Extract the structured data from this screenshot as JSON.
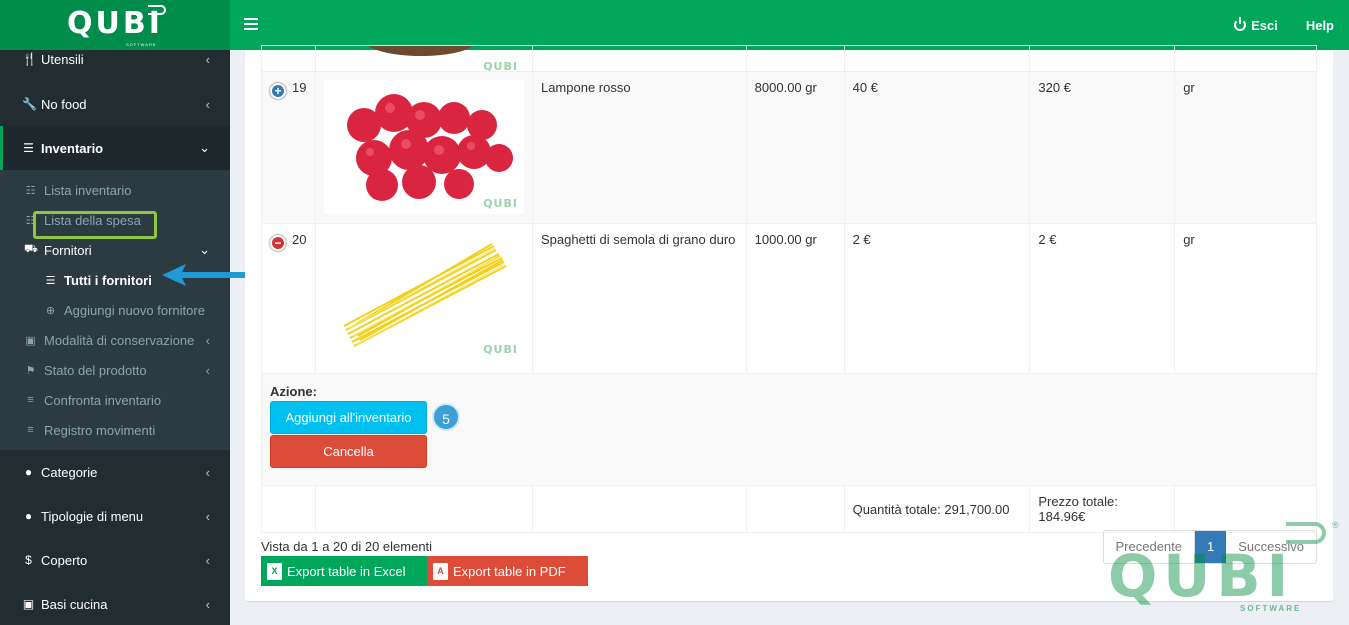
{
  "header": {
    "logo": "QUBI",
    "logo_sub": "SOFTWARE",
    "logout": "Esci",
    "help": "Help"
  },
  "sidebar": {
    "items": [
      {
        "label": "Utensili",
        "icon": "cutlery-icon"
      },
      {
        "label": "No food",
        "icon": "wrench-icon"
      },
      {
        "label": "Inventario",
        "icon": "table-icon"
      }
    ],
    "sub_items": [
      {
        "label": "Lista inventario"
      },
      {
        "label": "Lista della spesa"
      },
      {
        "label": "Fornitori"
      },
      {
        "label": "Tutti i fornitori"
      },
      {
        "label": "Aggiungi nuovo fornitore"
      },
      {
        "label": "Modalità di conservazione"
      },
      {
        "label": "Stato del prodotto"
      },
      {
        "label": "Confronta inventario"
      },
      {
        "label": "Registro movimenti"
      }
    ],
    "bottom_items": [
      {
        "label": "Categorie"
      },
      {
        "label": "Tipologie di menu"
      },
      {
        "label": "Coperto"
      },
      {
        "label": "Basi cucina"
      }
    ]
  },
  "table": {
    "rows": [
      {
        "id": "19",
        "name": "Lampone rosso",
        "qty": "8000.00 gr",
        "price": "40 €",
        "total": "320 €",
        "unit": "gr"
      },
      {
        "id": "20",
        "name": "Spaghetti di semola di grano duro",
        "qty": "1000.00 gr",
        "price": "2 €",
        "total": "2 €",
        "unit": "gr"
      }
    ],
    "watermark": "QUBI",
    "action_label": "Azione:",
    "add_button": "Aggiungi all'inventario",
    "cancel_button": "Cancella",
    "step": "5",
    "total_qty": "Quantità totale: 291,700.00",
    "total_price": "Prezzo totale: 184.96€"
  },
  "footer": {
    "info": "Vista da 1 a 20 di 20 elementi",
    "export_excel": "Export table in Excel",
    "export_pdf": "Export table in PDF",
    "pager_prev": "Precedente",
    "pager_page": "1",
    "pager_next": "Successivo",
    "watermark": "QUBI",
    "watermark_sub": "SOFTWARE",
    "watermark_reg": "®"
  }
}
